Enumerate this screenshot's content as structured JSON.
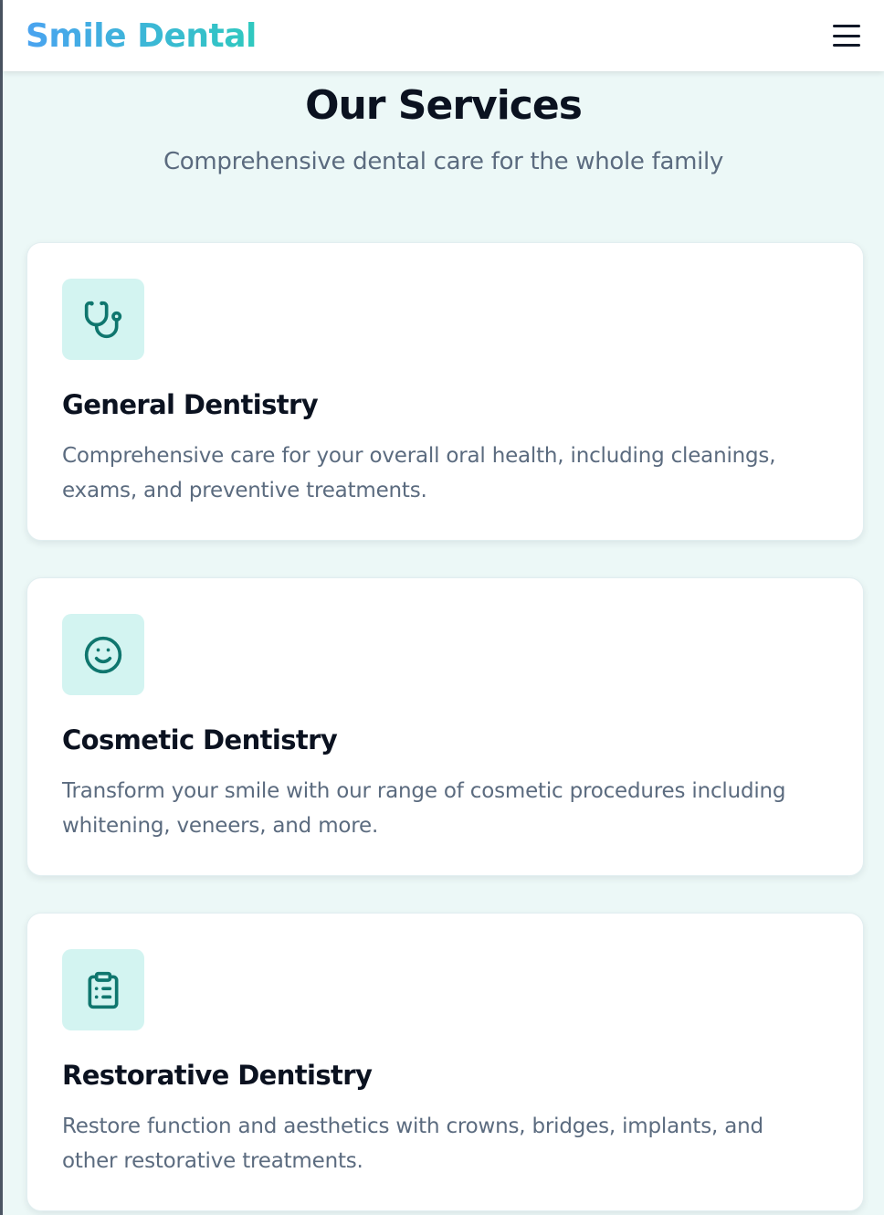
{
  "header": {
    "brand": "Smile Dental",
    "menu_icon": "hamburger-menu-icon"
  },
  "intro": {
    "title": "Our Services",
    "subtitle": "Comprehensive dental care for the whole family"
  },
  "colors": {
    "brand_gradient_start": "#4aa3f0",
    "brand_gradient_end": "#2fc9bf",
    "icon_bg": "#d3f4f1",
    "icon_stroke": "#0f766e",
    "page_bg": "#ecf8f7"
  },
  "services": [
    {
      "icon": "stethoscope-icon",
      "title": "General Dentistry",
      "description": "Comprehensive care for your overall oral health, including cleanings, exams, and preventive treatments."
    },
    {
      "icon": "smile-icon",
      "title": "Cosmetic Dentistry",
      "description": "Transform your smile with our range of cosmetic procedures including whitening, veneers, and more."
    },
    {
      "icon": "clipboard-list-icon",
      "title": "Restorative Dentistry",
      "description": "Restore function and aesthetics with crowns, bridges, implants, and other restorative treatments."
    }
  ]
}
